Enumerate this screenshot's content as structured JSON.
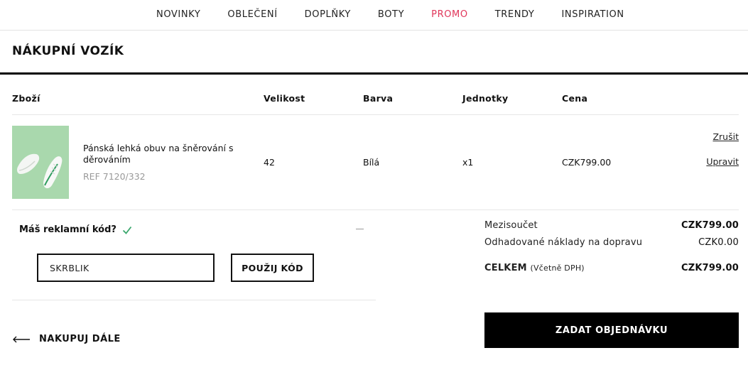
{
  "nav": {
    "items": [
      "NOVINKY",
      "OBLEČENÍ",
      "DOPLŇKY",
      "BOTY",
      "PROMO",
      "TRENDY",
      "INSPIRATION"
    ]
  },
  "page_title": "NÁKUPNÍ VOZÍK",
  "table": {
    "headers": [
      "Zboží",
      "Velikost",
      "Barva",
      "Jednotky",
      "Cena"
    ],
    "rows": [
      {
        "name": "Pánská lehká obuv na šněrování s děrováním",
        "ref": "REF 7120/332",
        "size": "42",
        "color": "Bílá",
        "units": "x1",
        "price": "CZK799.00",
        "cancel_label": "Zrušit",
        "edit_label": "Upravit"
      }
    ]
  },
  "promo": {
    "question": "Máš reklamní kód?",
    "code_value": "SKRBLIK",
    "apply_label": "POUŽIJ KÓD"
  },
  "continue_label": "NAKUPUJ DÁLE",
  "summary": {
    "subtotal_label": "Mezisoučet",
    "subtotal_value": "CZK799.00",
    "shipping_label": "Odhadované náklady na dopravu",
    "shipping_value": "CZK0.00",
    "total_label": "CELKEM",
    "total_note": "(Včetně DPH)",
    "total_value": "CZK799.00",
    "order_label": "ZADAT OBJEDNÁVKU"
  },
  "colors": {
    "accent_promo": "#e0365a",
    "thumbnail_bg": "#a9d8ad",
    "check": "#3aa76d",
    "button_bg": "#000000"
  },
  "icons": [
    "check-icon",
    "arrow-left-icon",
    "shoe-image"
  ]
}
